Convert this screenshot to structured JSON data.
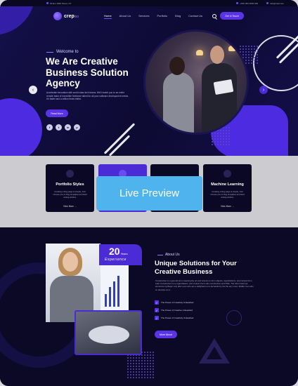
{
  "topbar": {
    "address": "00 Ext 1996 Street, NY",
    "hours": "Mon - Fri 09:00",
    "phone": "+000 000 0000 000",
    "email": "info@mail.com"
  },
  "brand": {
    "name": "crep",
    "suffix": "iso"
  },
  "nav": {
    "items": [
      "Home",
      "About Us",
      "Services",
      "Portfolio",
      "Blog",
      "Contact Us"
    ],
    "active": "Home",
    "cta_label": "Get in Touch"
  },
  "hero": {
    "eyebrow": "Welcome to",
    "title": "We Are Creative Business Solution Agency",
    "description": "Accelerate innovation with world class tech teams. We'll match you to an entire remote team of incredible freelance talent for all your software development needs. It's faster and a million times better.",
    "button_label": "Read More",
    "social": [
      "f",
      "t",
      "in",
      "p"
    ],
    "prev_arrow": "‹",
    "next_arrow": "›"
  },
  "cards": [
    {
      "title": "Portfolio Styles",
      "description": "Creating a blog page is simple. Just choose one of blog templates and start writing articles.",
      "link": "View More →"
    },
    {
      "title": "",
      "description": "",
      "link": ""
    },
    {
      "title": "",
      "description": "",
      "link": ""
    },
    {
      "title": "Machine Learning",
      "description": "Creating a blog page is simple. Just choose one of blog templates and start writing articles.",
      "link": "View More →"
    }
  ],
  "overlay": {
    "label": "Live Preview"
  },
  "about": {
    "years": "20",
    "years_unit": "Years",
    "experience_label": "Experience",
    "eyebrow": "About Us",
    "title": "Unique Solutions for Your Creative Business",
    "description": "Construction is a general term meaning the art and science to form objects, organizations, and context from Latin Construction is a organizations, and context from Latin construction and DNA. The other hand we announce rig Begin only after even who are a delighted not a demands by the the any more. Dislike men who so develop us to...",
    "checks": [
      "The Power of Creativity Unleashed",
      "The Power of Creative Unleashed",
      "The Power of Creativity Unleashed"
    ],
    "button_label": "More About"
  },
  "colors": {
    "accent": "#5a33e6",
    "overlay": "#4fb3ee",
    "background": "#0b0826",
    "band": "#cbcbd0"
  }
}
